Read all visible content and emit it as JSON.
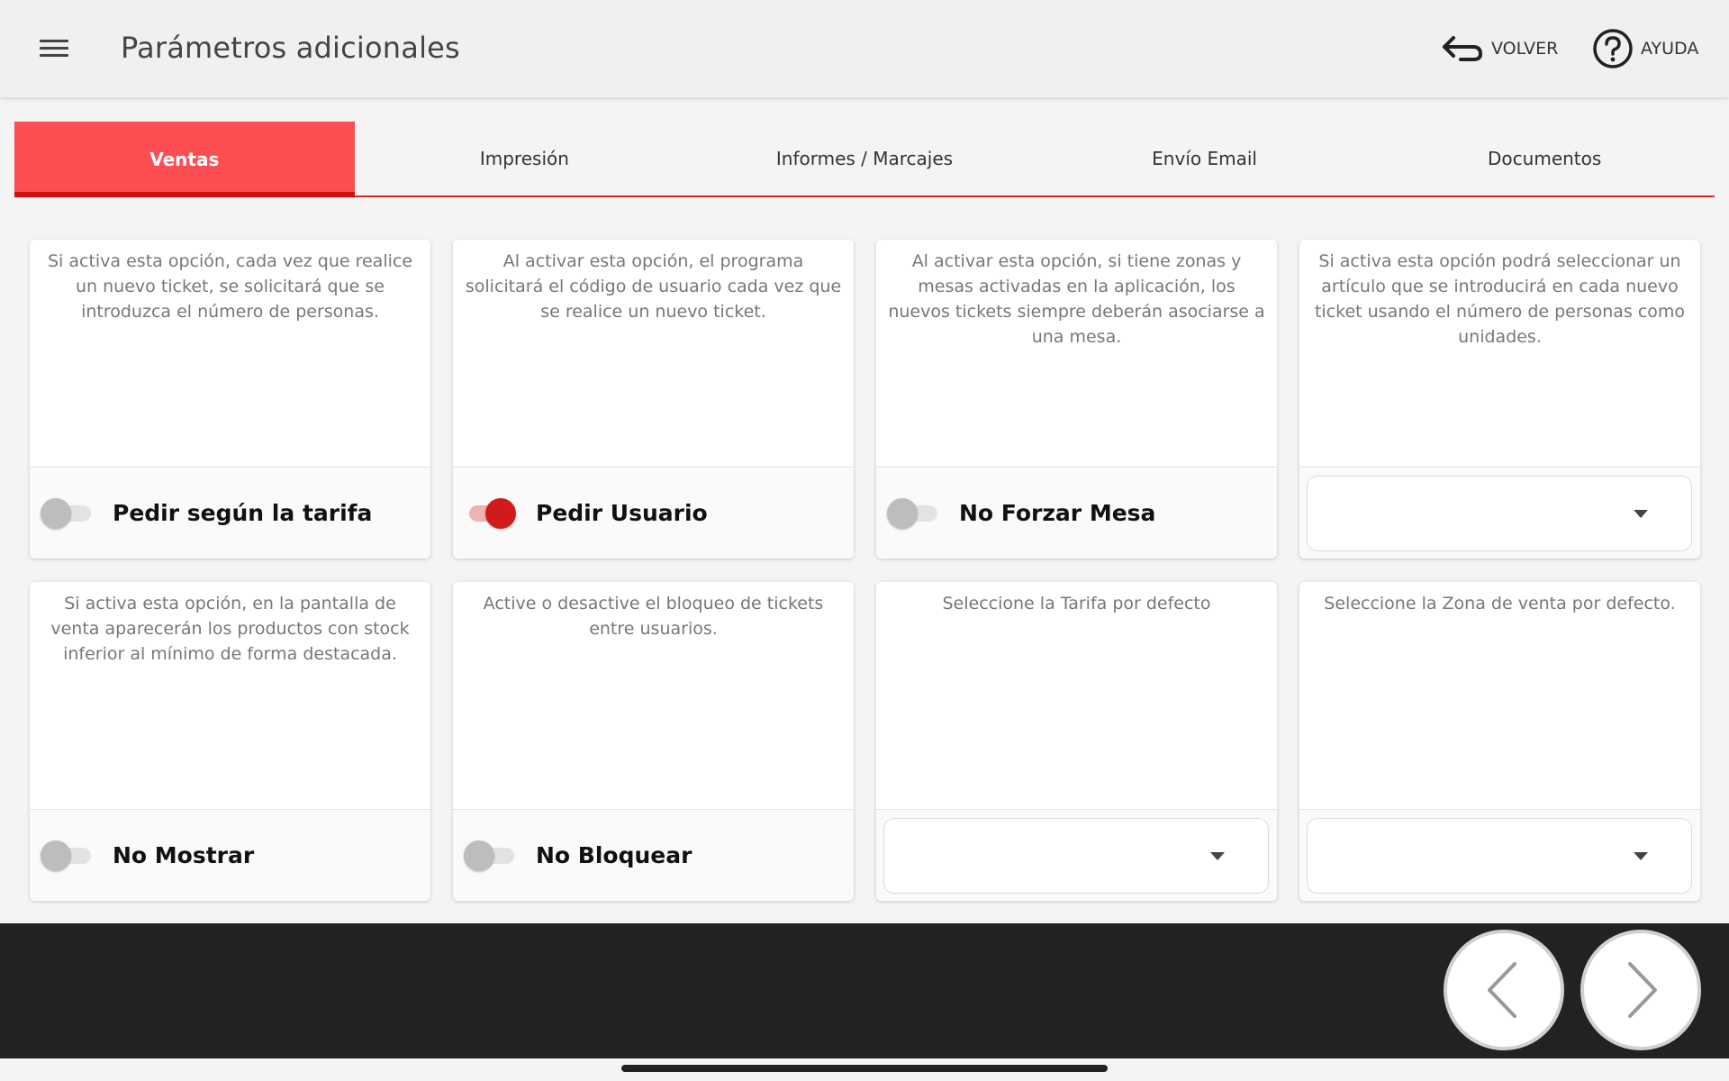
{
  "header": {
    "title": "Parámetros adicionales",
    "back_label": "VOLVER",
    "help_label": "AYUDA",
    "menu_icon": "hamburger-menu-icon",
    "back_icon": "return-arrow-icon",
    "help_icon": "help-circle-icon"
  },
  "tabs": [
    {
      "label": "Ventas",
      "active": true
    },
    {
      "label": "Impresión",
      "active": false
    },
    {
      "label": "Informes / Marcajes",
      "active": false
    },
    {
      "label": "Envío Email",
      "active": false
    },
    {
      "label": "Documentos",
      "active": false
    }
  ],
  "cards": [
    {
      "description": "Si activa esta opción, cada vez que realice un nuevo ticket, se solicitará que se introduzca el número de personas.",
      "control": "toggle",
      "on": false,
      "label": "Pedir según la tarifa"
    },
    {
      "description": "Al activar esta opción, el programa solicitará el código de usuario cada vez que se realice un nuevo ticket.",
      "control": "toggle",
      "on": true,
      "label": "Pedir Usuario"
    },
    {
      "description": "Al activar esta opción, si tiene zonas y mesas activadas en la aplicación, los nuevos tickets siempre deberán asociarse a una mesa.",
      "control": "toggle",
      "on": false,
      "label": "No Forzar Mesa"
    },
    {
      "description": "Si activa esta opción podrá seleccionar un artículo que se introducirá en cada nuevo ticket usando el número de personas como unidades.",
      "control": "select",
      "value": ""
    },
    {
      "description": "Si activa esta opción, en la pantalla de venta aparecerán los productos con stock inferior al mínimo de forma destacada.",
      "control": "toggle",
      "on": false,
      "label": "No Mostrar"
    },
    {
      "description": "Active o desactive el bloqueo de tickets entre usuarios.",
      "control": "toggle",
      "on": false,
      "label": "No Bloquear"
    },
    {
      "description": "Seleccione la Tarifa por defecto",
      "control": "select",
      "value": ""
    },
    {
      "description": "Seleccione la Zona de venta por defecto.",
      "control": "select",
      "value": ""
    }
  ],
  "navigation": {
    "prev_icon": "chevron-left-icon",
    "next_icon": "chevron-right-icon"
  },
  "colors": {
    "accent": "#fc4d52",
    "accent_dark": "#d40f12",
    "toggle_on": "#d11b1b",
    "bottom_bar": "#222222"
  }
}
